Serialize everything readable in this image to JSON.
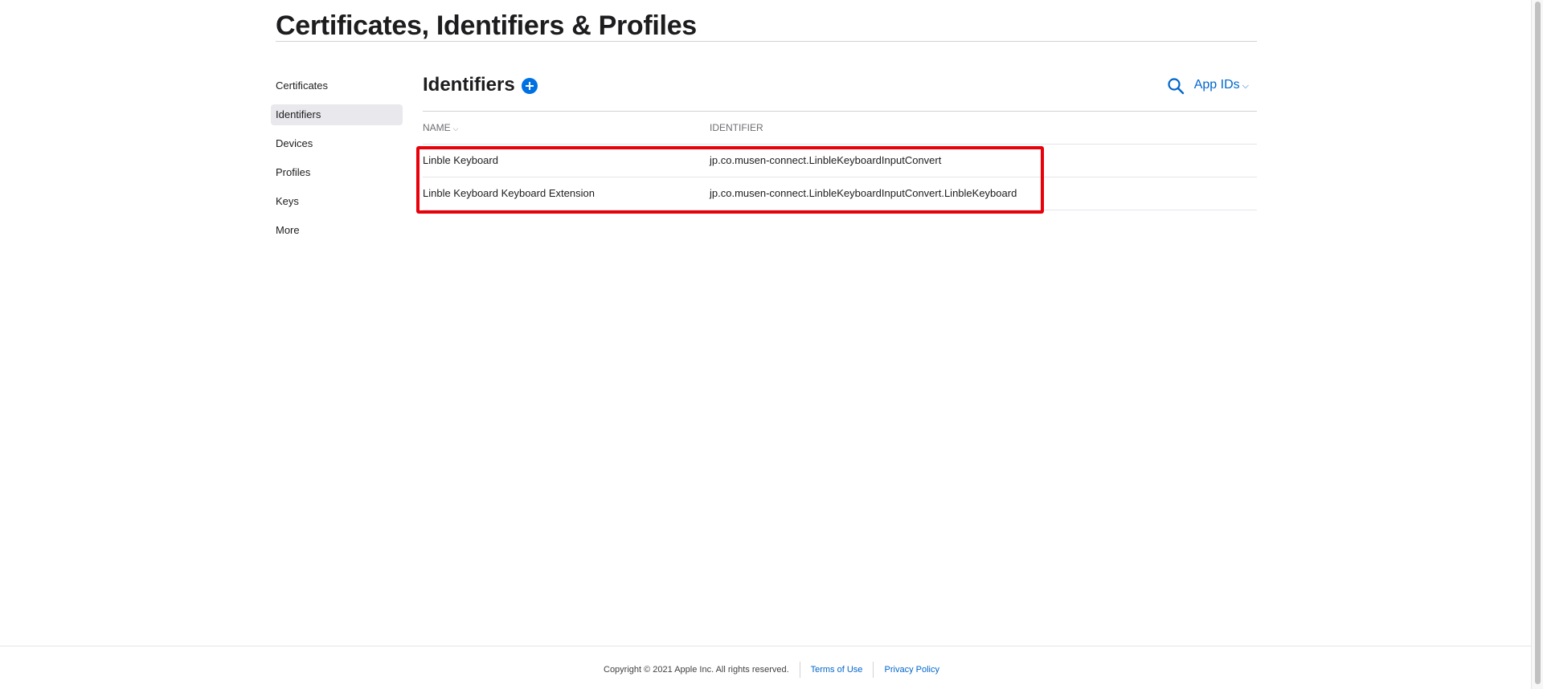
{
  "header": {
    "title": "Certificates, Identifiers & Profiles"
  },
  "sidebar": {
    "items": [
      {
        "label": "Certificates"
      },
      {
        "label": "Identifiers"
      },
      {
        "label": "Devices"
      },
      {
        "label": "Profiles"
      },
      {
        "label": "Keys"
      },
      {
        "label": "More"
      }
    ]
  },
  "main": {
    "section_title": "Identifiers",
    "filter_label": "App IDs",
    "table": {
      "columns": [
        "NAME",
        "IDENTIFIER"
      ],
      "rows": [
        {
          "name": "Linble Keyboard",
          "identifier": "jp.co.musen-connect.LinbleKeyboardInputConvert"
        },
        {
          "name": "Linble Keyboard Keyboard Extension",
          "identifier": "jp.co.musen-connect.LinbleKeyboardInputConvert.LinbleKeyboard"
        }
      ]
    }
  },
  "footer": {
    "copyright": "Copyright © 2021 Apple Inc. All rights reserved.",
    "terms": "Terms of Use",
    "privacy": "Privacy Policy"
  },
  "colors": {
    "accent": "#0066cc",
    "highlight": "#e8000b"
  },
  "icons": {
    "add": "plus-circle-icon",
    "search": "search-icon",
    "filter": "chevron-down-icon"
  }
}
